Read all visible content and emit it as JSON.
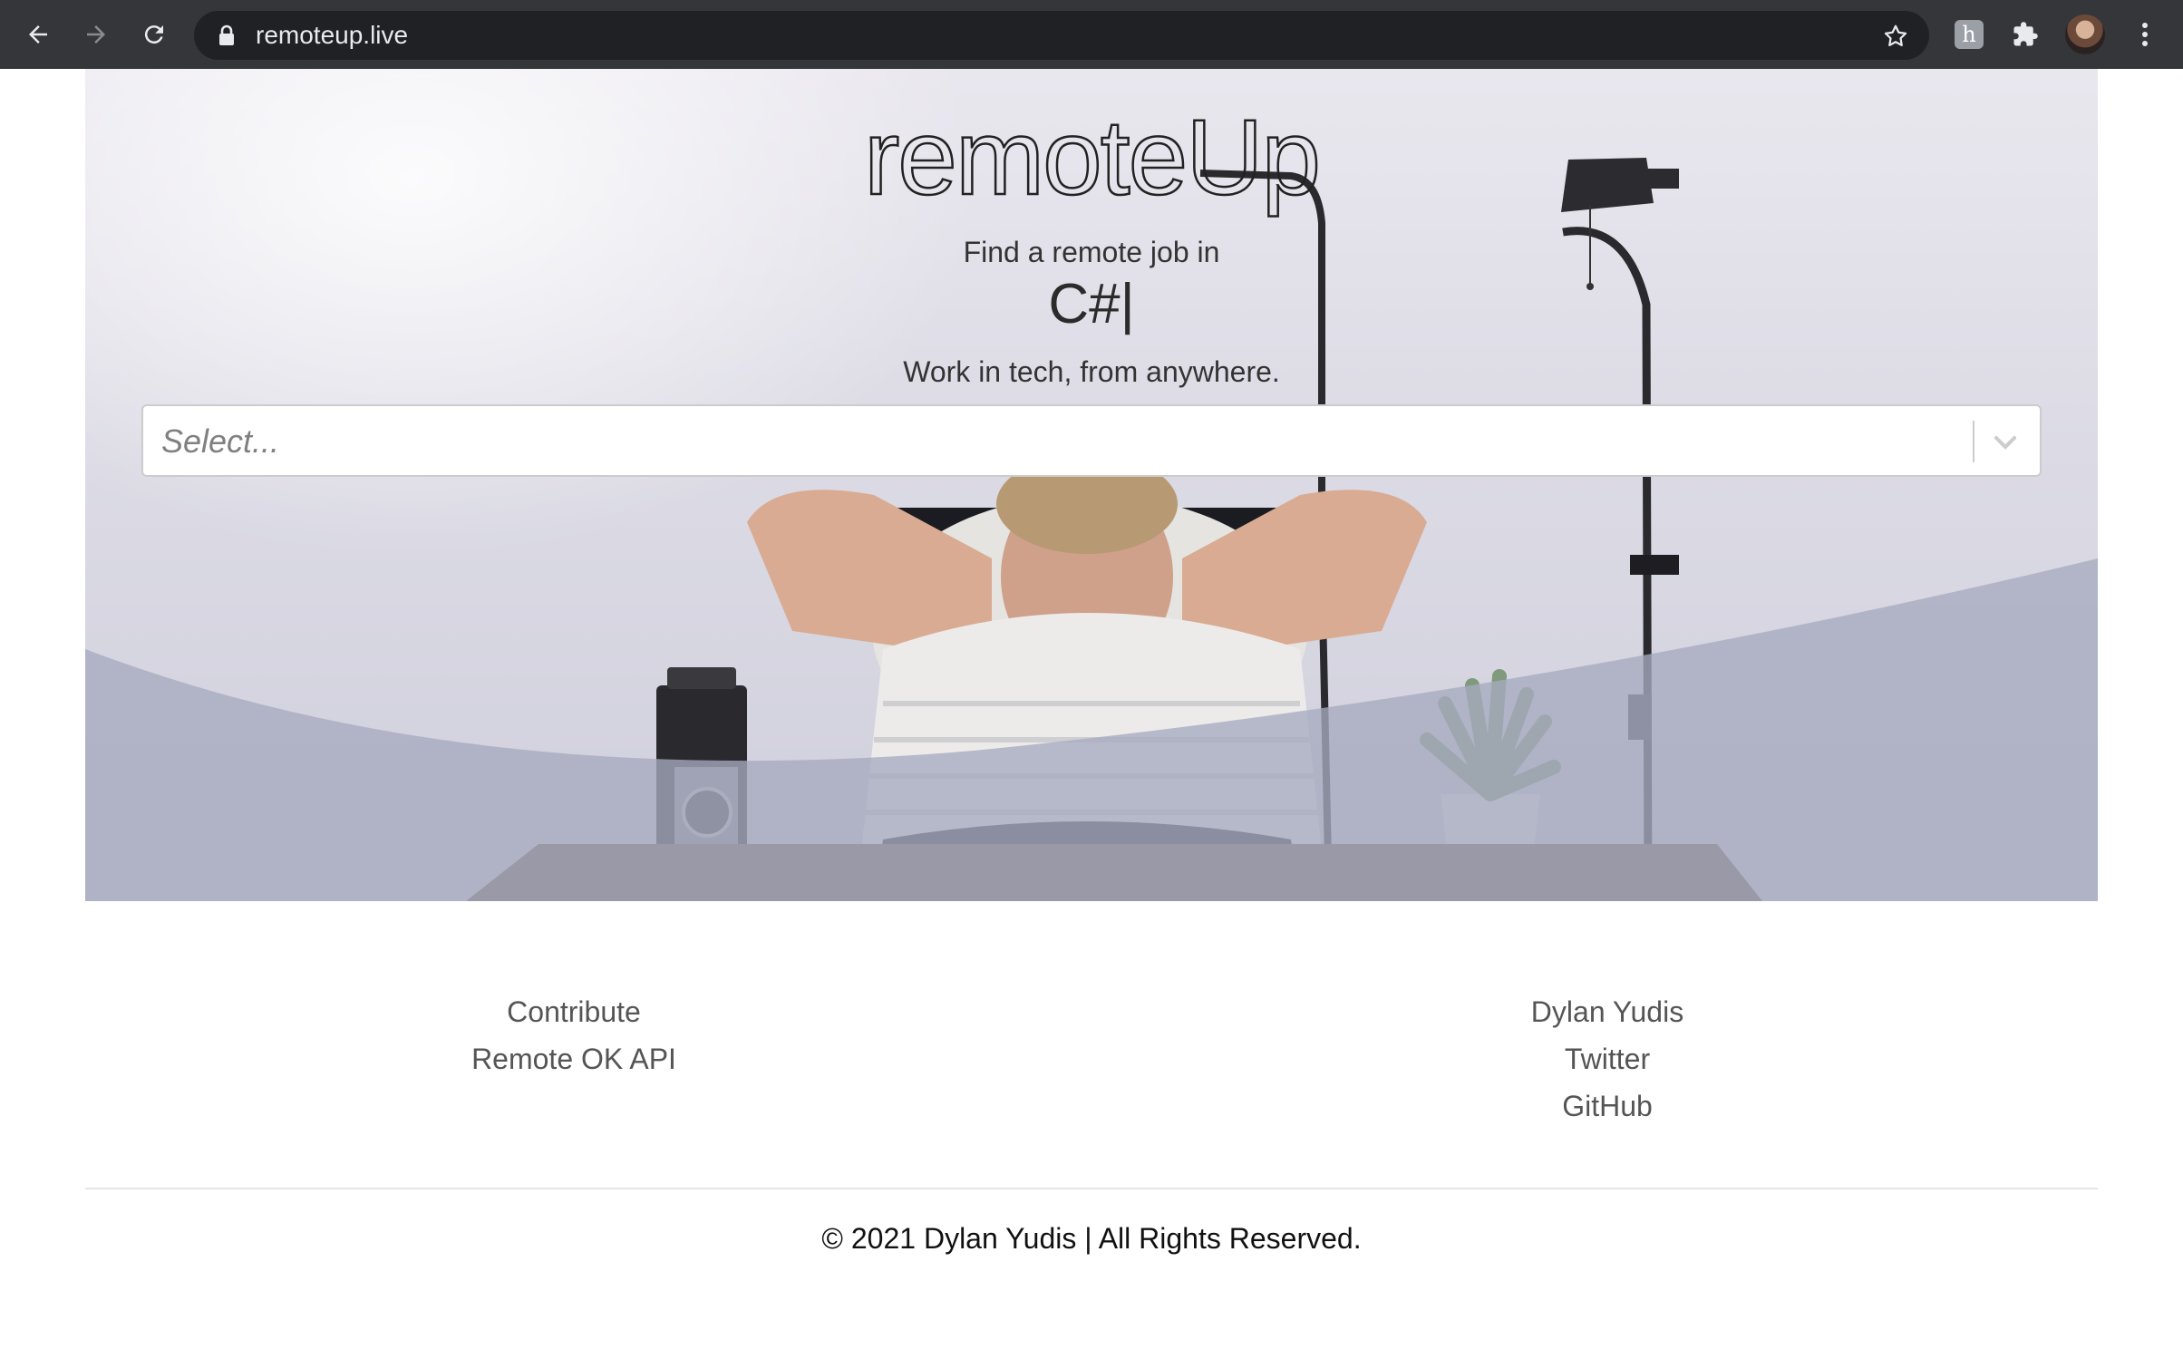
{
  "browser": {
    "url": "remoteup.live",
    "icons": [
      "back-icon",
      "forward-icon",
      "reload-icon",
      "lock-icon",
      "star-icon",
      "honey-extension-icon",
      "puzzle-icon",
      "profile-avatar",
      "more-icon"
    ]
  },
  "hero": {
    "brand": "remoteUp",
    "line1": "Find a remote job in",
    "typed": "C#|",
    "line3": "Work in tech, from anywhere.",
    "select": {
      "placeholder": "Select...",
      "value": ""
    },
    "colors": {
      "wave": "#a7aabf",
      "text": "#333333"
    }
  },
  "footer": {
    "left_links": [
      "Contribute",
      "Remote OK API"
    ],
    "right_links": [
      "Dylan Yudis",
      "Twitter",
      "GitHub"
    ],
    "copyright": "© 2021 Dylan Yudis | All Rights Reserved."
  }
}
